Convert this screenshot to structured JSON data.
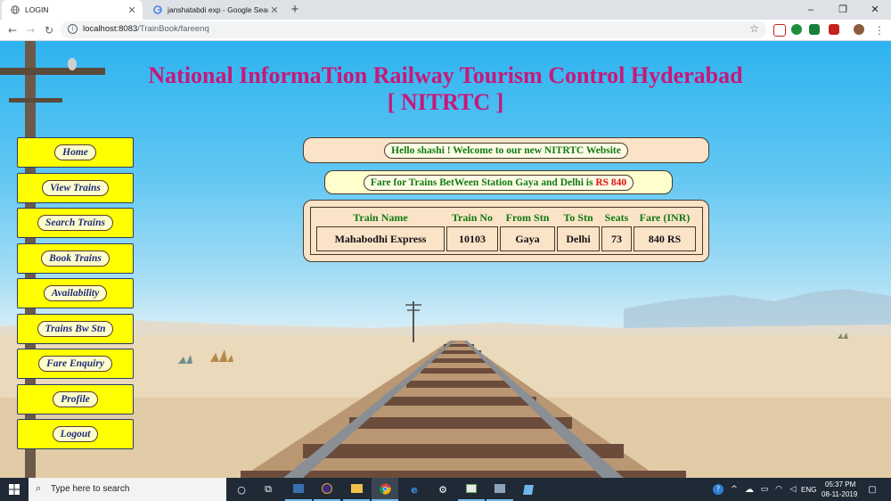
{
  "browser": {
    "tabs": [
      {
        "title": "LOGIN",
        "icon": "globe-icon",
        "active": true
      },
      {
        "title": "janshatabdi exp - Google Search",
        "icon": "google-icon",
        "active": false
      }
    ],
    "url_host": "localhost:8083",
    "url_path": "/TrainBook/fareenq",
    "window_controls": {
      "minimize": "–",
      "restore": "❐",
      "close": "✕"
    }
  },
  "site": {
    "title_line1": "National InformaTion Railway Tourism Control Hyderabad",
    "title_line2": "[ NITRTC ]"
  },
  "menu": [
    {
      "id": "home",
      "label": "Home"
    },
    {
      "id": "view-trains",
      "label": "View Trains"
    },
    {
      "id": "search-trains",
      "label": "Search Trains"
    },
    {
      "id": "book-trains",
      "label": "Book Trains"
    },
    {
      "id": "availability",
      "label": "Availability"
    },
    {
      "id": "trains-bw-stn",
      "label": "Trains Bw Stn"
    },
    {
      "id": "fare-enquiry",
      "label": "Fare Enquiry"
    },
    {
      "id": "profile",
      "label": "Profile"
    },
    {
      "id": "logout",
      "label": "Logout"
    }
  ],
  "welcome": {
    "text": "Hello shashi ! Welcome to our new NITRTC Website"
  },
  "fare": {
    "prefix": "Fare for Trains BetWeen Station Gaya and Delhi is",
    "amount": "RS 840"
  },
  "table": {
    "headers": [
      "Train Name",
      "Train No",
      "From Stn",
      "To Stn",
      "Seats",
      "Fare (INR)"
    ],
    "rows": [
      [
        "Mahabodhi Express",
        "10103",
        "Gaya",
        "Delhi",
        "73",
        "840 RS"
      ]
    ]
  },
  "taskbar": {
    "search_placeholder": "Type here to search",
    "language": "ENG",
    "time": "05:37 PM",
    "date": "08-11-2019"
  },
  "colors": {
    "title": "#c8187a",
    "menu_button": "#ffff00",
    "panel_peach": "#fbe3c8",
    "panel_yellow": "#ffffcc",
    "header_green": "#107a10",
    "fare_red": "#e01010"
  }
}
